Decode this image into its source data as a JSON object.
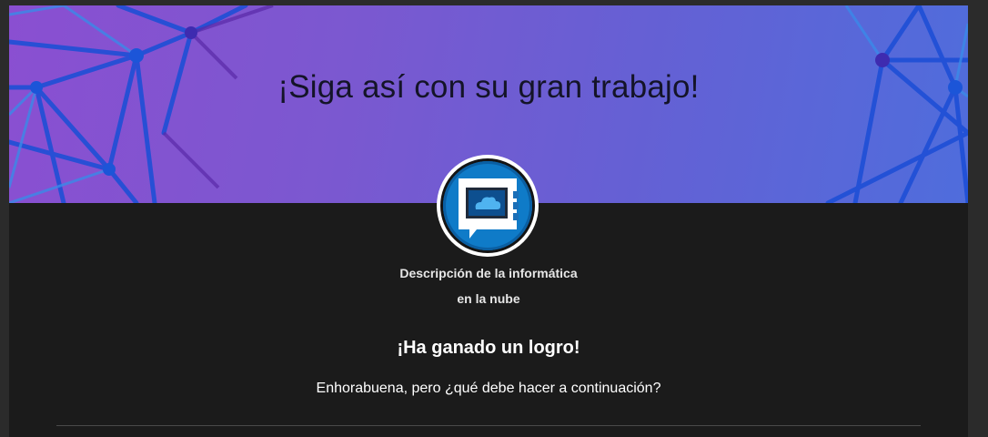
{
  "banner": {
    "title": "¡Siga así con su gran trabajo!"
  },
  "badge": {
    "icon": "cloud-monitor-badge-icon"
  },
  "module": {
    "title_line1": "Descripción de la informática",
    "title_line2": "en la nube"
  },
  "achievement": {
    "heading": "¡Ha ganado un logro!",
    "message": "Enhorabuena, pero ¿qué debe hacer a continuación?"
  },
  "colors": {
    "banner_start": "#8a4fd1",
    "banner_end": "#4f6ddc",
    "background": "#1b1b1b",
    "badge_blue": "#0f7bc8"
  }
}
